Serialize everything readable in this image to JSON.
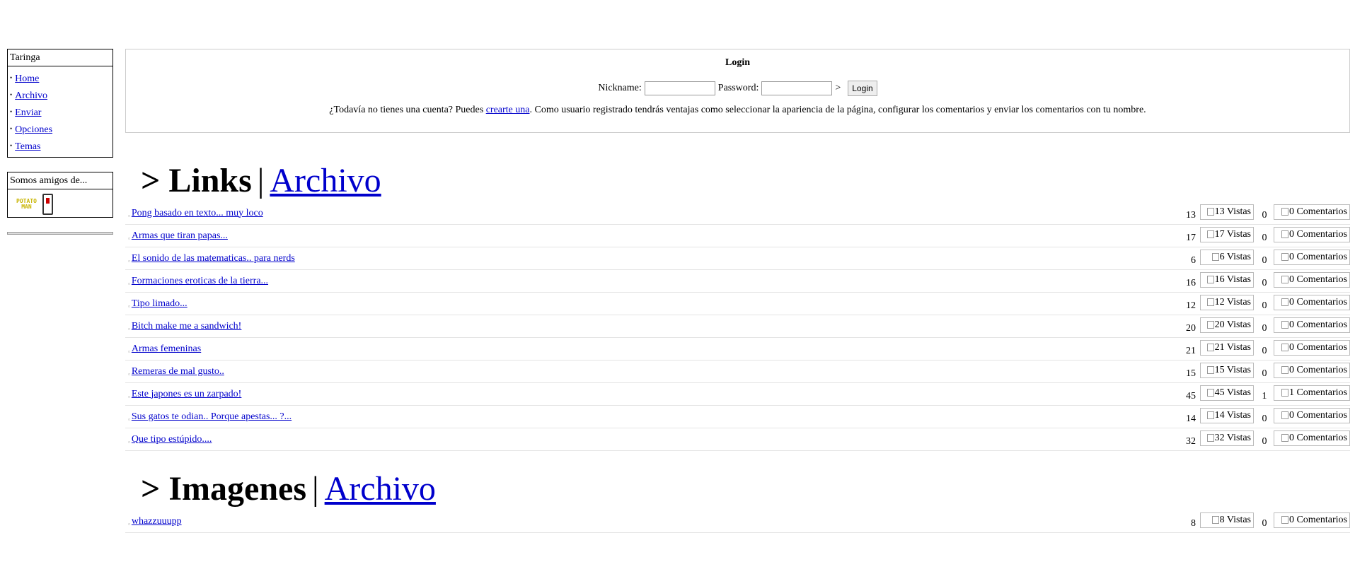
{
  "sidebar": {
    "title": "Taringa",
    "items": [
      {
        "label": "Home"
      },
      {
        "label": "Archivo"
      },
      {
        "label": "Enviar"
      },
      {
        "label": "Opciones"
      },
      {
        "label": "Temas"
      }
    ],
    "friends_title": "Somos amigos de...",
    "friends_logo": "POTATO MAN"
  },
  "login": {
    "title": "Login",
    "nickname_label": "Nickname:",
    "password_label": "Password:",
    "arrow": ">",
    "button": "Login",
    "note_before": "¿Todavía no tienes una cuenta? Puedes ",
    "note_link": "crearte una",
    "note_after": ". Como usuario registrado tendrás ventajas como seleccionar la apariencia de la página, configurar los comentarios y enviar los comentarios con tu nombre."
  },
  "links_section": {
    "prefix": ">",
    "title": "Links",
    "separator": "|",
    "archive": "Archivo",
    "rows": [
      {
        "title": "Pong basado en texto... muy loco",
        "views": "13",
        "views_alt": "13 Vistas",
        "comments": "0",
        "comments_alt": "0 Comentarios"
      },
      {
        "title": "Armas que tiran papas...",
        "views": "17",
        "views_alt": "17 Vistas",
        "comments": "0",
        "comments_alt": "0 Comentarios"
      },
      {
        "title": "El sonido de las matematicas.. para nerds",
        "views": "6",
        "views_alt": "6 Vistas",
        "comments": "0",
        "comments_alt": "0 Comentarios"
      },
      {
        "title": "Formaciones eroticas de la tierra...",
        "views": "16",
        "views_alt": "16 Vistas",
        "comments": "0",
        "comments_alt": "0 Comentarios"
      },
      {
        "title": "Tipo limado...",
        "views": "12",
        "views_alt": "12 Vistas",
        "comments": "0",
        "comments_alt": "0 Comentarios"
      },
      {
        "title": "Bitch make me a sandwich!",
        "views": "20",
        "views_alt": "20 Vistas",
        "comments": "0",
        "comments_alt": "0 Comentarios"
      },
      {
        "title": "Armas femeninas",
        "views": "21",
        "views_alt": "21 Vistas",
        "comments": "0",
        "comments_alt": "0 Comentarios"
      },
      {
        "title": "Remeras de mal gusto..",
        "views": "15",
        "views_alt": "15 Vistas",
        "comments": "0",
        "comments_alt": "0 Comentarios"
      },
      {
        "title": "Este japones es un zarpado!",
        "views": "45",
        "views_alt": "45 Vistas",
        "comments": "1",
        "comments_alt": "1 Comentarios"
      },
      {
        "title": "Sus gatos te odian.. Porque apestas... ?...",
        "views": "14",
        "views_alt": "14 Vistas",
        "comments": "0",
        "comments_alt": "0 Comentarios"
      },
      {
        "title": "Que tipo estúpido....",
        "views": "32",
        "views_alt": "32 Vistas",
        "comments": "0",
        "comments_alt": "0 Comentarios"
      }
    ]
  },
  "images_section": {
    "prefix": ">",
    "title": "Imagenes",
    "separator": "|",
    "archive": "Archivo",
    "rows": [
      {
        "title": "whazzuuupp",
        "views": "8",
        "views_alt": "8 Vistas",
        "comments": "0",
        "comments_alt": "0 Comentarios"
      }
    ]
  }
}
